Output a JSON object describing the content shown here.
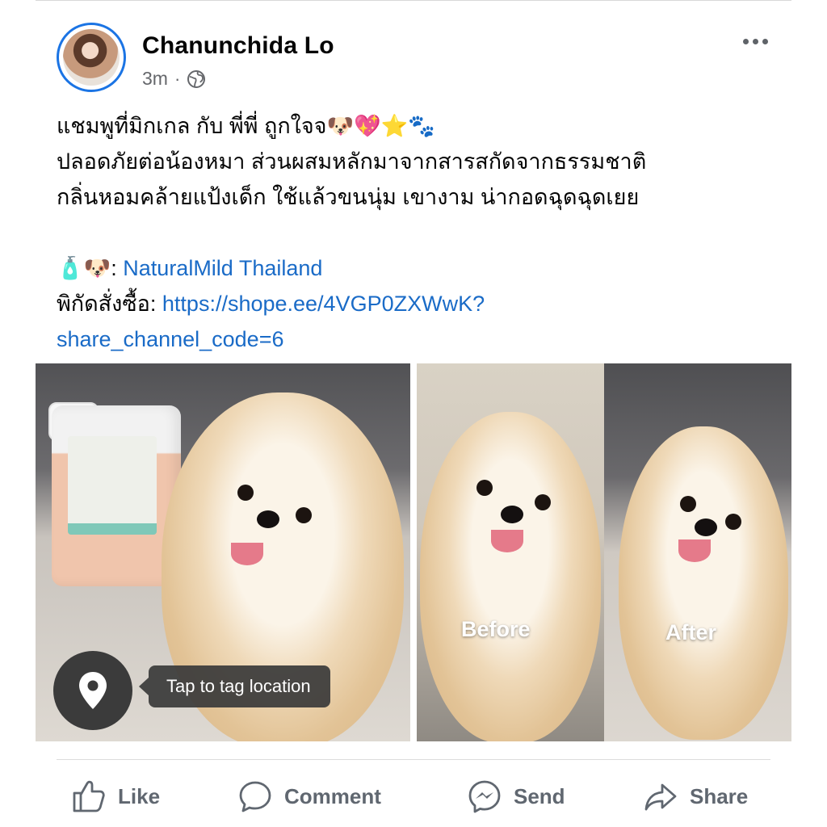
{
  "post": {
    "author": "Chanunchida Lo",
    "time": "3m",
    "separator": "·",
    "privacy_icon": "globe-icon",
    "lines": [
      "แชมพูที่มิกเกล กับ พี่พี่ ถูกใจจ🐶💖⭐🐾",
      "ปลอดภัยต่อน้องหมา ส่วนผสมหลักมาจากสารสกัดจากธรรมชาติ",
      "กลิ่นหอมคล้ายแป้งเด็ก ใช้แล้วขนนุ่ม เขางาม น่ากอดฉุดฉุดเยย"
    ],
    "product_emoji": "🧴🐶",
    "product_colon": ":",
    "product_link": "NaturalMild Thailand",
    "order_label": "พิกัดสั่งซื้อ:",
    "order_url_part1": "https://shope.ee/4VGP0ZXWwK?",
    "order_url_part2": "share_channel_code=6"
  },
  "media": {
    "before_label": "Before",
    "after_label": "After",
    "tag_location": "Tap to tag location"
  },
  "actions": {
    "like": "Like",
    "comment": "Comment",
    "send": "Send",
    "share": "Share"
  },
  "colors": {
    "link": "#1a6bc7",
    "avatar_ring": "#1b74e4",
    "action_gray": "#606770"
  }
}
